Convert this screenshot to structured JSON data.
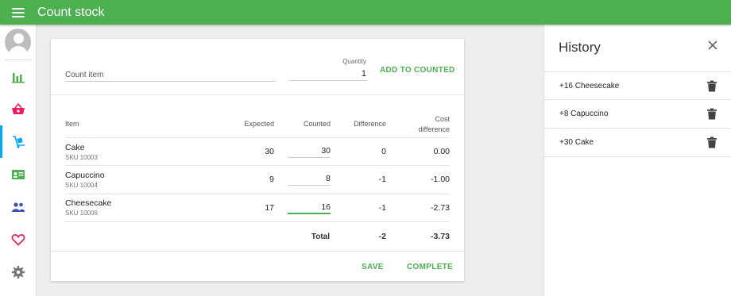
{
  "header": {
    "title": "Count stock"
  },
  "sidebar": {
    "items": [
      {
        "icon": "bar-chart-icon",
        "color": "#4caf50"
      },
      {
        "icon": "basket-icon",
        "color": "#e91e63"
      },
      {
        "icon": "dolly-icon",
        "color": "#03a9f4",
        "active": true
      },
      {
        "icon": "id-card-icon",
        "color": "#4caf50"
      },
      {
        "icon": "people-icon",
        "color": "#3f51b5"
      },
      {
        "icon": "heart-icon",
        "color": "#e91e63"
      },
      {
        "icon": "gear-icon",
        "color": "#757575"
      }
    ]
  },
  "count_form": {
    "item_placeholder": "Count item",
    "quantity_label": "Quantity",
    "quantity_value": "1",
    "add_button": "ADD TO COUNTED"
  },
  "table": {
    "headers": {
      "item": "Item",
      "expected": "Expected",
      "counted": "Counted",
      "difference": "Difference",
      "cost_difference_line1": "Cost",
      "cost_difference_line2": "difference"
    },
    "rows": [
      {
        "name": "Cake",
        "sku": "SKU 10003",
        "expected": "30",
        "counted": "30",
        "difference": "0",
        "cost_difference": "0.00"
      },
      {
        "name": "Capuccino",
        "sku": "SKU 10004",
        "expected": "9",
        "counted": "8",
        "difference": "-1",
        "cost_difference": "-1.00"
      },
      {
        "name": "Cheesecake",
        "sku": "SKU 10006",
        "expected": "17",
        "counted": "16",
        "difference": "-1",
        "cost_difference": "-2.73"
      }
    ],
    "total": {
      "label": "Total",
      "difference": "-2",
      "cost_difference": "-3.73"
    }
  },
  "actions": {
    "save": "SAVE",
    "complete": "COMPLETE"
  },
  "history": {
    "title": "History",
    "entries": [
      {
        "text": "+16 Cheesecake"
      },
      {
        "text": "+8 Capuccino"
      },
      {
        "text": "+30 Cake"
      }
    ]
  },
  "colors": {
    "brand": "#4caf50",
    "active_nav": "#03a9f4"
  }
}
